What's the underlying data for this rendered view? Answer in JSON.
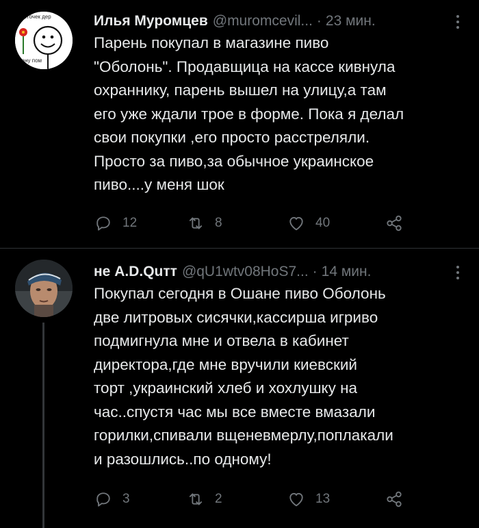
{
  "tweets": [
    {
      "name": "Илья Муромцев",
      "handle": "@muromcevil...",
      "time": "23 мин.",
      "text": "Парень покупал в магазине пиво\n\"Оболонь\". Продавщица на кассе кивнула\nохраннику, парень вышел на улицу,а там\nего уже ждали трое в форме. Пока я делал\nсвои покупки ,его просто расстреляли.\nПросто за пиво,за обычное украинское\nпиво....у меня шок",
      "avatar_text": "цветочек дерево\nкану пом",
      "replies": "12",
      "retweets": "8",
      "likes": "40"
    },
    {
      "name": "не A.D.Quтт",
      "handle": "@qU1wtv08HoS7...",
      "time": "14 мин.",
      "text": "Покупал сегодня в Ошане пиво Оболонь\nдве литровых сисячки,кассирша игриво\nподмигнула мне и отвела в кабинет\nдиректора,где мне вручили киевский\nторт ,украинский хлеб и хохлушку на\nчас..спустя час мы все вместе вмазали\nгорилки,спивали вщеневмерлу,поплакали\nи разошлись..по одному!",
      "replies": "3",
      "retweets": "2",
      "likes": "13"
    }
  ],
  "icons": {
    "reply": "reply-icon",
    "retweet": "retweet-icon",
    "like": "heart-icon",
    "share": "share-icon",
    "more": "more-icon"
  },
  "colors": {
    "background": "#000000",
    "text": "#e7e9ea",
    "secondary": "#71767b",
    "divider": "#2f3336"
  }
}
